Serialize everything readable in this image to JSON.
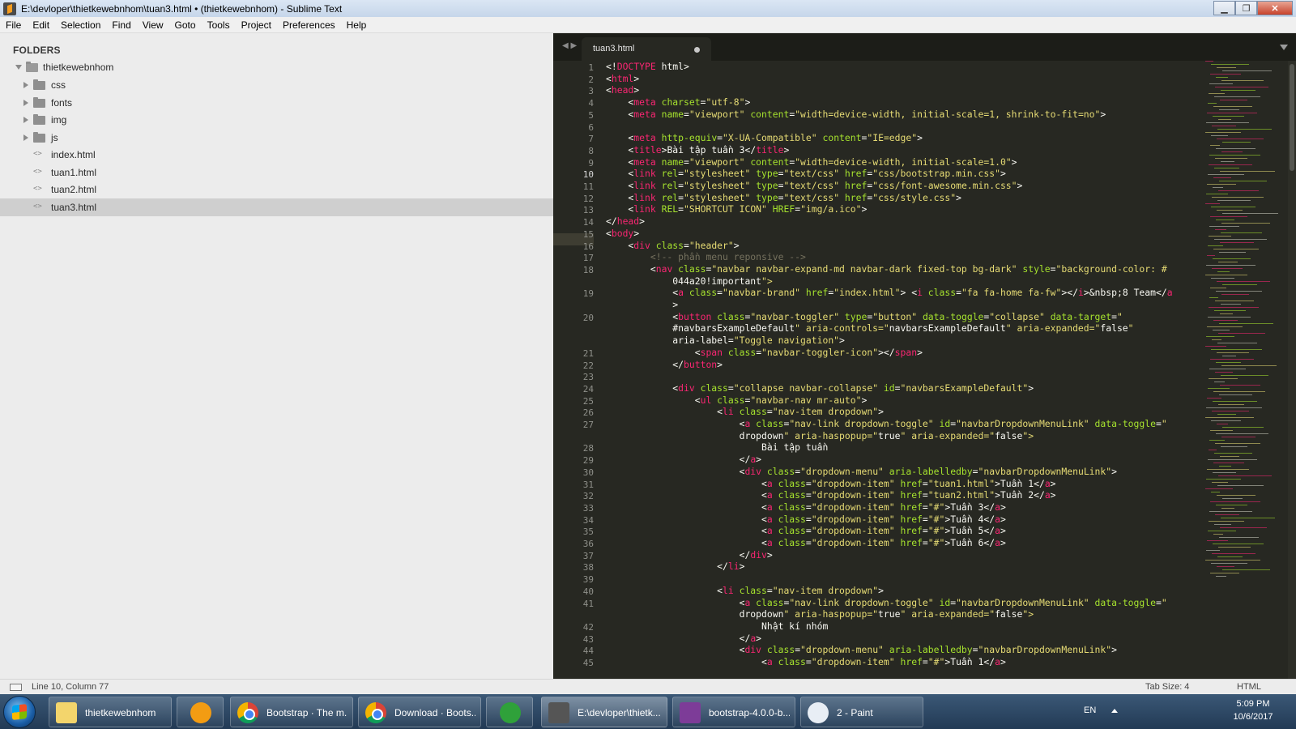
{
  "window": {
    "title": "E:\\devloper\\thietkewebnhom\\tuan3.html • (thietkewebnhom) - Sublime Text"
  },
  "menu": [
    "File",
    "Edit",
    "Selection",
    "Find",
    "View",
    "Goto",
    "Tools",
    "Project",
    "Preferences",
    "Help"
  ],
  "sidebar": {
    "header": "FOLDERS",
    "root": "thietkewebnhom",
    "items": [
      {
        "label": "css",
        "type": "folder"
      },
      {
        "label": "fonts",
        "type": "folder"
      },
      {
        "label": "img",
        "type": "folder"
      },
      {
        "label": "js",
        "type": "folder"
      },
      {
        "label": "index.html",
        "type": "file"
      },
      {
        "label": "tuan1.html",
        "type": "file"
      },
      {
        "label": "tuan2.html",
        "type": "file"
      },
      {
        "label": "tuan3.html",
        "type": "file",
        "selected": true
      }
    ]
  },
  "editor": {
    "tab_name": "tuan3.html",
    "nav": "◀ ▶",
    "current_line": 10,
    "line_numbers": [
      "1",
      "2",
      "3",
      "4",
      "5",
      "6",
      "7",
      "8",
      "9",
      "10",
      "11",
      "12",
      "13",
      "14",
      "15",
      "16",
      "17",
      "18",
      "",
      "19",
      "",
      "20",
      "",
      "",
      "21",
      "22",
      "23",
      "24",
      "25",
      "26",
      "27",
      "",
      "28",
      "29",
      "30",
      "31",
      "32",
      "33",
      "34",
      "35",
      "36",
      "37",
      "38",
      "39",
      "40",
      "41",
      "",
      "42",
      "43",
      "44",
      "45"
    ],
    "lines": [
      "<!DOCTYPE html>",
      "<html>",
      "<head>",
      "    <meta charset=\"utf-8\">",
      "    <meta name=\"viewport\" content=\"width=device-width, initial-scale=1, shrink-to-fit=no\">",
      "",
      "    <meta http-equiv=\"X-UA-Compatible\" content=\"IE=edge\">",
      "    <title>Bài tập tuần 3</title>",
      "    <meta name=\"viewport\" content=\"width=device-width, initial-scale=1.0\">",
      "    <link rel=\"stylesheet\" type=\"text/css\" href=\"css/bootstrap.min.css\">",
      "    <link rel=\"stylesheet\" type=\"text/css\" href=\"css/font-awesome.min.css\">",
      "    <link rel=\"stylesheet\" type=\"text/css\" href=\"css/style.css\">",
      "    <link REL=\"SHORTCUT ICON\" HREF=\"img/a.ico\">",
      "</head>",
      "<body>",
      "    <div class=\"header\">",
      "        <!-- phần menu reponsive -->",
      "        <nav class=\"navbar navbar-expand-md navbar-dark fixed-top bg-dark\" style=\"background-color: #",
      "            044a20!important\">",
      "            <a class=\"navbar-brand\" href=\"index.html\"> <i class=\"fa fa-home fa-fw\"></i>&nbsp;8 Team</a",
      "            >",
      "            <button class=\"navbar-toggler\" type=\"button\" data-toggle=\"collapse\" data-target=\"",
      "            #navbarsExampleDefault\" aria-controls=\"navbarsExampleDefault\" aria-expanded=\"false\"",
      "            aria-label=\"Toggle navigation\">",
      "                <span class=\"navbar-toggler-icon\"></span>",
      "            </button>",
      "",
      "            <div class=\"collapse navbar-collapse\" id=\"navbarsExampleDefault\">",
      "                <ul class=\"navbar-nav mr-auto\">",
      "                    <li class=\"nav-item dropdown\">",
      "                        <a class=\"nav-link dropdown-toggle\" id=\"navbarDropdownMenuLink\" data-toggle=\"",
      "                        dropdown\" aria-haspopup=\"true\" aria-expanded=\"false\">",
      "                            Bài tập tuần",
      "                        </a>",
      "                        <div class=\"dropdown-menu\" aria-labelledby=\"navbarDropdownMenuLink\">",
      "                            <a class=\"dropdown-item\" href=\"tuan1.html\">Tuần 1</a>",
      "                            <a class=\"dropdown-item\" href=\"tuan2.html\">Tuần 2</a>",
      "                            <a class=\"dropdown-item\" href=\"#\">Tuần 3</a>",
      "                            <a class=\"dropdown-item\" href=\"#\">Tuần 4</a>",
      "                            <a class=\"dropdown-item\" href=\"#\">Tuần 5</a>",
      "                            <a class=\"dropdown-item\" href=\"#\">Tuần 6</a>",
      "                        </div>",
      "                    </li>",
      "",
      "                    <li class=\"nav-item dropdown\">",
      "                        <a class=\"nav-link dropdown-toggle\" id=\"navbarDropdownMenuLink\" data-toggle=\"",
      "                        dropdown\" aria-haspopup=\"true\" aria-expanded=\"false\">",
      "                            Nhật kí nhóm",
      "                        </a>",
      "                        <div class=\"dropdown-menu\" aria-labelledby=\"navbarDropdownMenuLink\">",
      "                            <a class=\"dropdown-item\" href=\"#\">Tuần 1</a>"
    ]
  },
  "statusbar": {
    "position": "Line 10, Column 77",
    "tab_size": "Tab Size: 4",
    "syntax": "HTML"
  },
  "taskbar": {
    "items": [
      {
        "label": "thietkewebnhom",
        "icon": "folder-icon"
      },
      {
        "label": "",
        "icon": "media-player-icon"
      },
      {
        "label": "Bootstrap · The m...",
        "icon": "chrome-icon"
      },
      {
        "label": "Download · Boots...",
        "icon": "chrome-icon"
      },
      {
        "label": "",
        "icon": "coccoc-icon"
      },
      {
        "label": "E:\\devloper\\thietk...",
        "icon": "sublime-icon"
      },
      {
        "label": "bootstrap-4.0.0-b...",
        "icon": "winrar-icon"
      },
      {
        "label": "2 - Paint",
        "icon": "paint-icon"
      }
    ],
    "lang": "EN",
    "time": "5:09 PM",
    "date": "10/6/2017"
  },
  "colors": {
    "tag": "#f92672",
    "attr": "#a6e22e",
    "string": "#e6db74",
    "comment": "#75715e",
    "text": "#f8f8f2",
    "keyword": "#66d9ef"
  }
}
